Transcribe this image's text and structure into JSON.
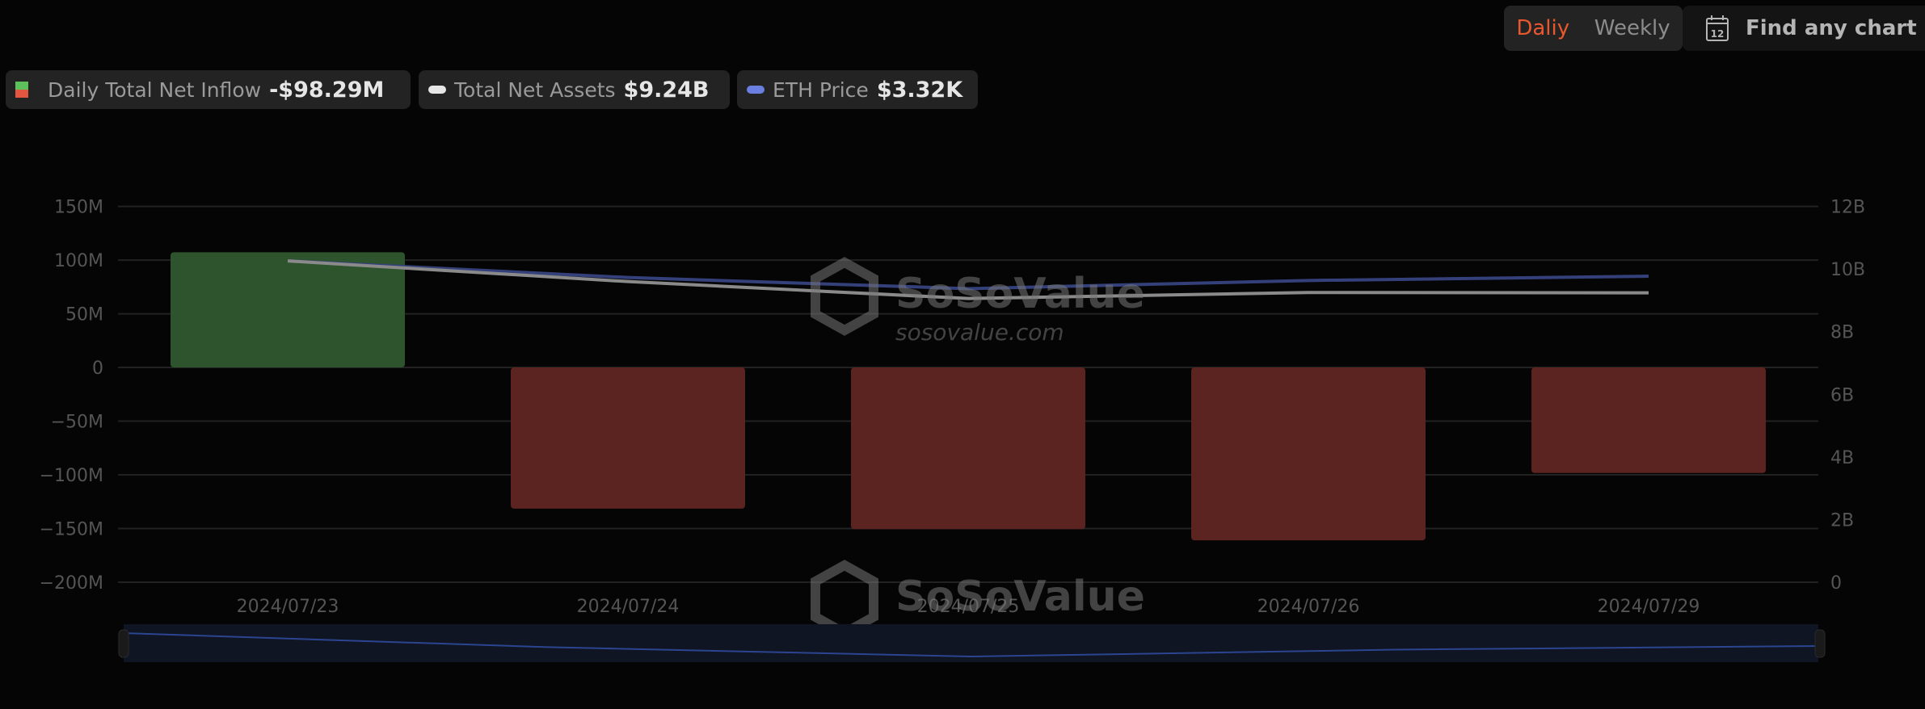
{
  "legend": [
    {
      "label": "Daily Total Net Inflow",
      "value": "-$98.29M",
      "icon": "green-red-square-icon"
    },
    {
      "label": "Total Net Assets",
      "value": "$9.24B",
      "icon": "line-swatch-icon",
      "color": "#e6e6e6"
    },
    {
      "label": "ETH Price",
      "value": "$3.32K",
      "icon": "line-swatch-icon",
      "color": "#6b7fe0"
    }
  ],
  "period_toggle": {
    "daily": "Daliy",
    "weekly": "Weekly",
    "active": "daily",
    "active_color": "#e8582f"
  },
  "find_chart": {
    "label": "Find any chart",
    "icon": "calendar-icon",
    "icon_text": "12"
  },
  "watermark": {
    "brand": "SoSoValue",
    "url": "sosovalue.com"
  },
  "chart_data": {
    "type": "bar",
    "categories": [
      "2024/07/23",
      "2024/07/24",
      "2024/07/25",
      "2024/07/26",
      "2024/07/29"
    ],
    "y_left": {
      "ticks": [
        "150M",
        "100M",
        "50M",
        "0",
        "−50M",
        "−100M",
        "−150M",
        "−200M"
      ],
      "range": [
        -200,
        150
      ],
      "unit": "M"
    },
    "y_right": {
      "ticks": [
        "12B",
        "10B",
        "8B",
        "6B",
        "4B",
        "2B",
        "0"
      ],
      "range": [
        0,
        12
      ],
      "unit": "B"
    },
    "grid": true,
    "colors": {
      "positive": "#2d542c",
      "negative": "#5c2420",
      "net_assets": "#8a8a8a",
      "eth_price": "#34407a"
    },
    "series": [
      {
        "name": "Daily Total Net Inflow",
        "type": "bar",
        "axis": "left",
        "values": [
          107.3,
          -131.5,
          -150.6,
          -161.0,
          -98.29
        ]
      },
      {
        "name": "Total Net Assets",
        "type": "line",
        "axis": "right",
        "values": [
          10.26,
          9.6,
          9.06,
          9.25,
          9.24
        ]
      },
      {
        "name": "ETH Price",
        "type": "line",
        "axis": "hidden",
        "values": [
          3480,
          3306,
          3190,
          3275,
          3320
        ]
      }
    ]
  }
}
